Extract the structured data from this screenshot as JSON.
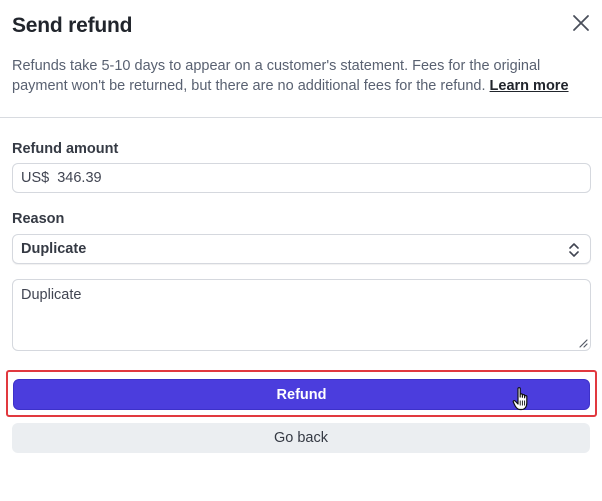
{
  "dialog": {
    "title": "Send refund",
    "description": "Refunds take 5-10 days to appear on a customer's statement. Fees for the original payment won't be returned, but there are no additional fees for the refund.",
    "learn_more_label": "Learn more",
    "close_icon": "close-icon"
  },
  "form": {
    "amount_label": "Refund amount",
    "currency": "US$",
    "amount_value": "346.39",
    "reason_label": "Reason",
    "reason_selected": "Duplicate",
    "reason_chevron_icon": "chevron-up-down-icon",
    "note_value": "Duplicate"
  },
  "actions": {
    "refund_label": "Refund",
    "go_back_label": "Go back",
    "highlight_color": "#e1393f",
    "primary_color": "#4b3ddd"
  },
  "cursor_icon": "hand-pointer-icon"
}
